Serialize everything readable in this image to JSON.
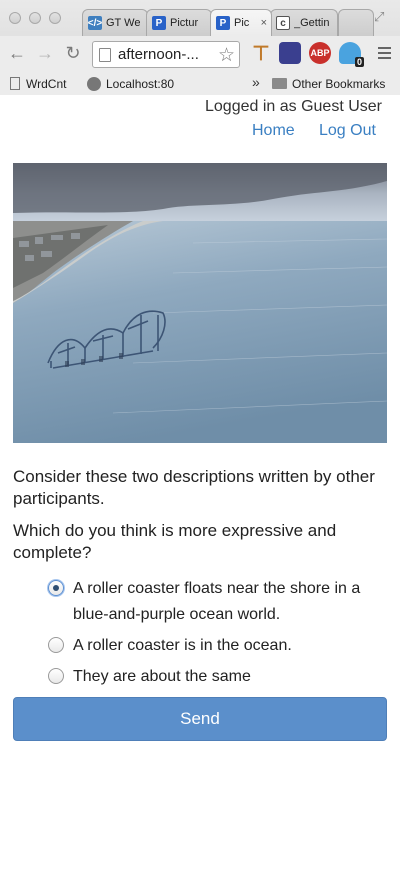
{
  "browser": {
    "tabs": [
      {
        "title": "GT We",
        "icon": "code-icon",
        "color": "#3f7fbf",
        "glyph": "</>"
      },
      {
        "title": "Pictur",
        "icon": "p-icon",
        "color": "#2962c8",
        "glyph": "P"
      },
      {
        "title": "Pic",
        "icon": "p-icon",
        "color": "#2962c8",
        "glyph": "P",
        "close": "×"
      },
      {
        "title": "_Gettin",
        "icon": "c-icon",
        "color": "#444444",
        "glyph": "c"
      }
    ],
    "address": "afternoon-...",
    "extensions": {
      "abp": "ABP",
      "ghostery_badge": "0"
    },
    "bookmarks": {
      "wrdcnt": "WrdCnt",
      "localhost": "Localhost:80",
      "more": "»",
      "other": "Other Bookmarks"
    }
  },
  "header": {
    "status": "Logged in as Guest User",
    "home": "Home",
    "logout": "Log Out"
  },
  "prompt": {
    "intro": "Consider these two descriptions written by other participants.",
    "question": "Which do you think is more expressive and complete?"
  },
  "options": [
    {
      "label": "A roller coaster floats near the shore in a blue-and-purple ocean world.",
      "checked": true
    },
    {
      "label": "A roller coaster is in the ocean.",
      "checked": false
    },
    {
      "label": "They are about the same",
      "checked": false
    }
  ],
  "submit": {
    "label": "Send"
  },
  "colors": {
    "link": "#3a7fc2",
    "button": "#5b8fcb"
  }
}
